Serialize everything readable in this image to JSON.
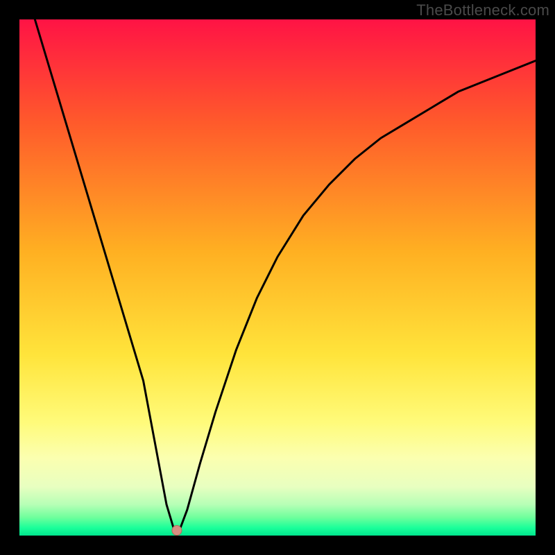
{
  "watermark": "TheBottleneck.com",
  "colors": {
    "frame": "#000000",
    "curve": "#000000",
    "marker_fill": "#d58f82",
    "marker_stroke": "#b56a5a",
    "gradient_stops": [
      {
        "offset": 0.0,
        "color": "#ff1345"
      },
      {
        "offset": 0.2,
        "color": "#ff5a2b"
      },
      {
        "offset": 0.45,
        "color": "#ffb022"
      },
      {
        "offset": 0.65,
        "color": "#ffe43b"
      },
      {
        "offset": 0.78,
        "color": "#fffb7a"
      },
      {
        "offset": 0.85,
        "color": "#fbffb0"
      },
      {
        "offset": 0.905,
        "color": "#e8ffc0"
      },
      {
        "offset": 0.94,
        "color": "#b6ffb6"
      },
      {
        "offset": 0.965,
        "color": "#6eff9c"
      },
      {
        "offset": 0.985,
        "color": "#1aff9a"
      },
      {
        "offset": 1.0,
        "color": "#00e58d"
      }
    ]
  },
  "chart_data": {
    "type": "line",
    "title": "",
    "xlabel": "",
    "ylabel": "",
    "xlim": [
      0,
      100
    ],
    "ylim": [
      0,
      100
    ],
    "series": [
      {
        "name": "bottleneck-curve",
        "x": [
          0,
          3,
          6,
          9,
          12,
          15,
          18,
          21,
          24,
          27,
          28.5,
          30,
          31,
          32.5,
          35,
          38,
          42,
          46,
          50,
          55,
          60,
          65,
          70,
          75,
          80,
          85,
          90,
          95,
          100
        ],
        "values": [
          110,
          100,
          90,
          80,
          70,
          60,
          50,
          40,
          30,
          14,
          6,
          1,
          1,
          5,
          14,
          24,
          36,
          46,
          54,
          62,
          68,
          73,
          77,
          80,
          83,
          86,
          88,
          90,
          92
        ]
      }
    ],
    "marker": {
      "x": 30.5,
      "y": 1
    }
  }
}
